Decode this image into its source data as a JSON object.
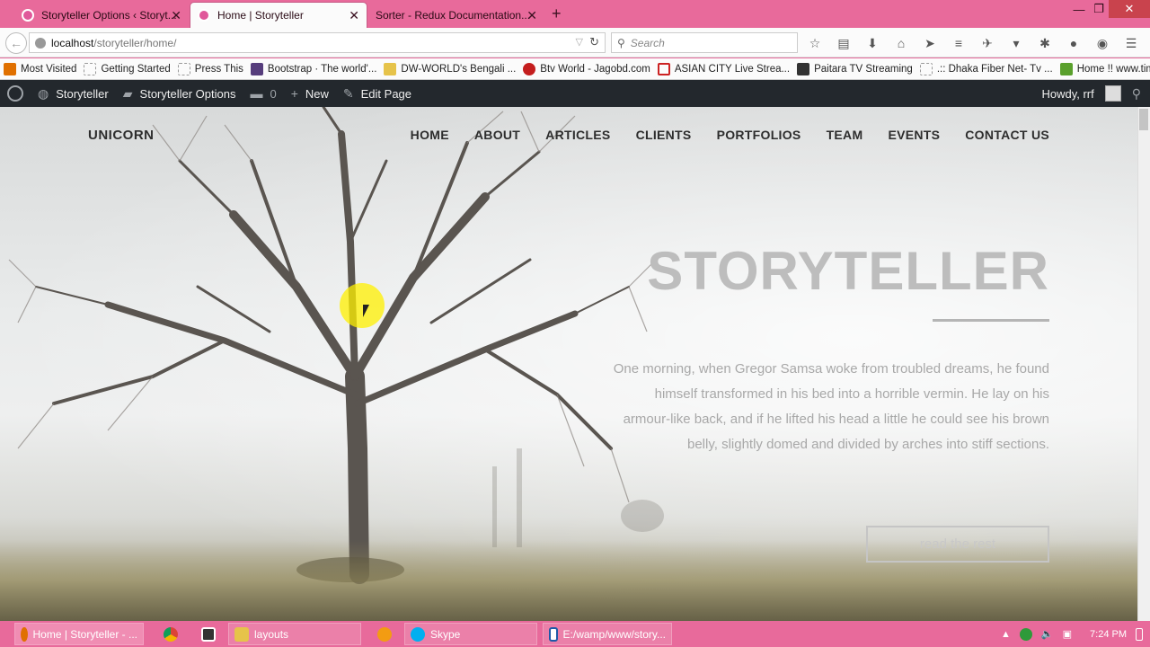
{
  "browser": {
    "tabs": [
      {
        "title": "Storyteller Options ‹ Storyt...",
        "active": false
      },
      {
        "title": "Home | Storyteller",
        "active": true
      },
      {
        "title": "Sorter - Redux Documentation...",
        "active": false
      }
    ],
    "url_host": "localhost",
    "url_path": "/storyteller/home/",
    "search_placeholder": "Search",
    "window_controls": {
      "minimize": "—",
      "maximize": "❐",
      "close": "✕"
    }
  },
  "bookmarks": [
    {
      "label": "Most Visited",
      "icon": "firefox-icon",
      "color": "#e07000"
    },
    {
      "label": "Getting Started",
      "icon": "page-icon",
      "color": "#dddddd"
    },
    {
      "label": "Press This",
      "icon": "page-icon",
      "color": "#dddddd"
    },
    {
      "label": "Bootstrap · The world'...",
      "icon": "bootstrap-icon",
      "color": "#563d7c"
    },
    {
      "label": "DW-WORLD's Bengali ...",
      "icon": "folder-icon",
      "color": "#e6c34a"
    },
    {
      "label": "Btv World - Jagobd.com",
      "icon": "btv-icon",
      "color": "#c41e1e"
    },
    {
      "label": "ASIAN CITY Live Strea...",
      "icon": "asian-city-icon",
      "color": "#cc2222"
    },
    {
      "label": "Paitara TV Streaming",
      "icon": "tv-icon",
      "color": "#333333"
    },
    {
      "label": ".:: Dhaka Fiber Net- Tv ...",
      "icon": "page-icon",
      "color": "#dddddd"
    },
    {
      "label": "Home !! www.timepas...",
      "icon": "timepass-icon",
      "color": "#5aa02c"
    }
  ],
  "wp_admin": {
    "site": "Storyteller",
    "options": "Storyteller Options",
    "comments": "0",
    "new": "New",
    "edit": "Edit Page",
    "howdy": "Howdy, rrf"
  },
  "site": {
    "brand": "UNICORN",
    "nav": [
      "HOME",
      "ABOUT",
      "ARTICLES",
      "CLIENTS",
      "PORTFOLIOS",
      "TEAM",
      "EVENTS",
      "CONTACT US"
    ],
    "hero_title": "STORYTELLER",
    "hero_text": "One morning, when Gregor Samsa woke from troubled dreams, he found himself transformed in his bed into a horrible vermin. He lay on his armour-like back, and if he lifted his head a little he could see his brown belly, slightly domed and divided by arches into stiff sections.",
    "hero_button": "read the rest"
  },
  "taskbar": {
    "items": [
      {
        "label": "Home | Storyteller - ...",
        "icon": "firefox-icon"
      },
      {
        "label": "",
        "icon": "chrome-icon"
      },
      {
        "label": "",
        "icon": "app-icon"
      },
      {
        "label": "layouts",
        "icon": "folder-icon"
      },
      {
        "label": "",
        "icon": "media-player-icon"
      },
      {
        "label": "Skype",
        "icon": "skype-icon"
      },
      {
        "label": "E:/wamp/www/story...",
        "icon": "editor-icon"
      }
    ],
    "clock": "7:24 PM"
  },
  "colors": {
    "taskbar": "#e86a9b",
    "wpbar": "#23282d",
    "hero_title": "#bdbdbd"
  }
}
